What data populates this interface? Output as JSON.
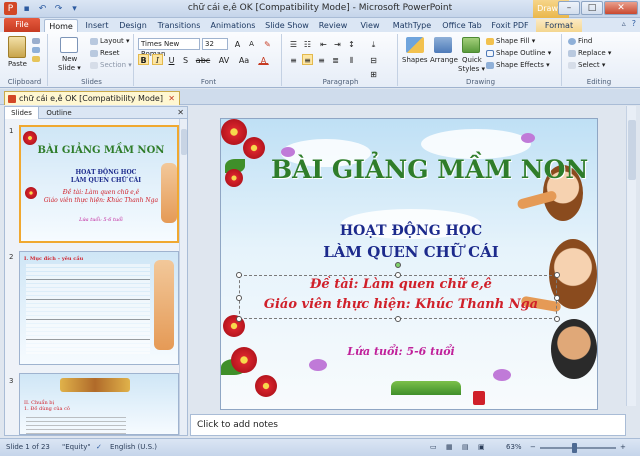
{
  "window": {
    "title": "chữ cái e,ê OK [Compatibility Mode] - Microsoft PowerPoint",
    "contextual_tab_group": "Draw...",
    "buttons": {
      "minimize": "–",
      "maximize": "□",
      "close": "✕"
    }
  },
  "tabs": [
    "File",
    "Home",
    "Insert",
    "Design",
    "Transitions",
    "Animations",
    "Slide Show",
    "Review",
    "View",
    "MathType",
    "Office Tab",
    "Foxit PDF",
    "Format"
  ],
  "ribbon": {
    "clipboard": {
      "label": "Clipboard",
      "paste": "Paste"
    },
    "slides": {
      "label": "Slides",
      "new_slide": "New",
      "new_slide2": "Slide ▾",
      "layout": "Layout ▾",
      "reset": "Reset",
      "section": "Section ▾"
    },
    "font": {
      "label": "Font",
      "font_name": "Times New Roman",
      "font_size": "32",
      "bold": "B",
      "italic": "I",
      "underline": "U",
      "strike": "S",
      "shadow": "abc",
      "spacing": "AV",
      "case": "Aa",
      "color": "A"
    },
    "paragraph": {
      "label": "Paragraph"
    },
    "drawing": {
      "label": "Drawing",
      "shapes": "Shapes",
      "arrange": "Arrange",
      "quick_styles": "Quick",
      "quick_styles2": "Styles ▾",
      "shape_fill": "Shape Fill ▾",
      "shape_outline": "Shape Outline ▾",
      "shape_effects": "Shape Effects ▾"
    },
    "editing": {
      "label": "Editing",
      "find": "Find",
      "replace": "Replace ▾",
      "select": "Select ▾"
    }
  },
  "document_tab": {
    "title": "chữ cái e,ê OK [Compatibility Mode]",
    "close": "✕"
  },
  "left_panel": {
    "tabs": [
      "Slides",
      "Outline"
    ],
    "close": "✕",
    "thumbs": [
      {
        "number": "1",
        "title": "BÀI GIẢNG MẦM NON",
        "sub1": "HOẠT ĐỘNG HỌC",
        "sub2": "LÀM QUEN CHỮ CÁI",
        "line1": "Đề tài: Làm quen chữ e,ê",
        "line2": "Giáo viên thực hiện: Khúc Thanh Nga",
        "age": "Lứa tuổi: 5-6 tuổi"
      },
      {
        "number": "2",
        "lines": [
          "I. Mục đích – yêu cầu"
        ]
      },
      {
        "number": "3",
        "lines": [
          "II. Chuẩn bị",
          "1. Đồ dùng của cô"
        ]
      }
    ]
  },
  "slide": {
    "title": "BÀI GIẢNG MẦM NON",
    "subtitle1": "HOẠT ĐỘNG HỌC",
    "subtitle2": "LÀM QUEN CHỮ CÁI",
    "topic": "Đề tài: Làm quen chữ e,ê",
    "teacher": "Giáo viên thực hiện: Khúc Thanh Nga",
    "age": "Lứa tuổi: 5-6 tuổi"
  },
  "notes": {
    "placeholder": "Click to add notes"
  },
  "status": {
    "slide_info": "Slide 1 of 23",
    "theme": "\"Equity\"",
    "language": "English (U.S.)",
    "zoom": "63%"
  },
  "colors": {
    "file_tab": "#c63b22",
    "slide_title": "#2f7d2a",
    "slide_subtitle": "#1c2a8c",
    "slide_topic": "#d0202a",
    "slide_age": "#c0209a"
  }
}
